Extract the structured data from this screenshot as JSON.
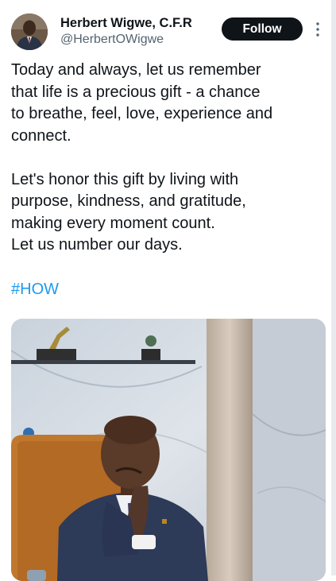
{
  "author": {
    "name": "Herbert Wigwe, C.F.R",
    "handle": "@HerbertOWigwe"
  },
  "follow_label": "Follow",
  "paragraphs": [
    "Today and always, let us remember\nthat life is a precious gift - a chance\nto breathe, feel, love, experience and\nconnect.",
    "Let's honor this gift by living with\npurpose, kindness, and gratitude,\nmaking every moment count.\nLet us number our days."
  ],
  "hashtag": "#HOW",
  "icons": {
    "more": "more-vertical-icon"
  },
  "colors": {
    "text": "#0f1419",
    "secondary": "#536471",
    "link": "#1d9bf0",
    "button": "#0f1419"
  }
}
